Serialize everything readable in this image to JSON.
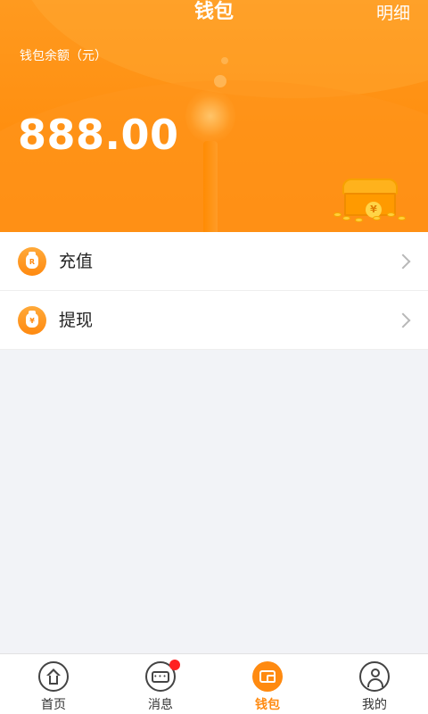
{
  "header": {
    "title": "钱包",
    "detail_label": "明细"
  },
  "balance": {
    "label": "钱包余额（元）",
    "amount": "888.00"
  },
  "actions": [
    {
      "label": "充值",
      "icon": "money-bag-icon"
    },
    {
      "label": "提现",
      "icon": "money-bag-yuan-icon"
    }
  ],
  "tabbar": {
    "items": [
      {
        "label": "首页",
        "icon": "home-icon"
      },
      {
        "label": "消息",
        "icon": "message-icon",
        "badge": true
      },
      {
        "label": "钱包",
        "icon": "wallet-icon",
        "active": true
      },
      {
        "label": "我的",
        "icon": "user-icon"
      }
    ]
  },
  "colors": {
    "accent": "#ff8a10",
    "badge": "#ff2222",
    "background": "#f2f3f7"
  }
}
